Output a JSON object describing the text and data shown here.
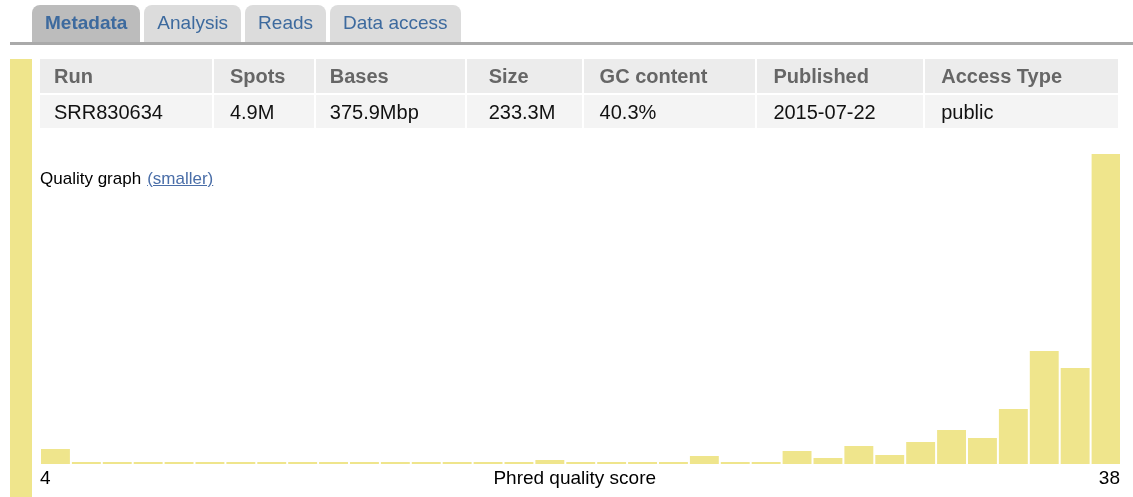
{
  "tabs": [
    {
      "label": "Metadata",
      "selected": true
    },
    {
      "label": "Analysis",
      "selected": false
    },
    {
      "label": "Reads",
      "selected": false
    },
    {
      "label": "Data access",
      "selected": false
    }
  ],
  "table": {
    "columns": [
      "Run",
      "Spots",
      "Bases",
      "Size",
      "GC content",
      "Published",
      "Access Type"
    ],
    "rows": [
      [
        "SRR830634",
        "4.9M",
        "375.9Mbp",
        "233.3M",
        "40.3%",
        "2015-07-22",
        "public"
      ]
    ]
  },
  "quality_graph": {
    "label": "Quality graph",
    "link": "(smaller)",
    "x_start": "4",
    "x_end": "38",
    "xlabel": "Phred quality score"
  }
}
